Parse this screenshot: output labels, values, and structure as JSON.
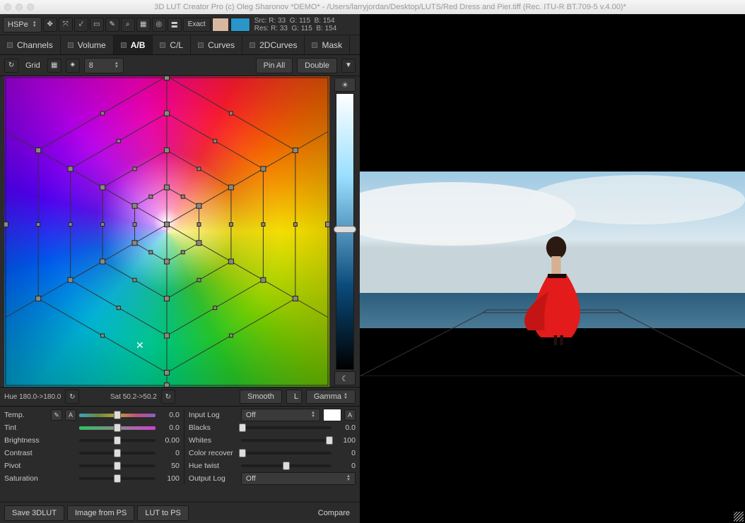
{
  "window": {
    "title": "3D LUT Creator Pro (c) Oleg Sharonov *DEMO* - /Users/larryjordan/Desktop/LUTS/Red Dress and Pier.tiff (Rec. ITU-R BT.709-5 v.4.00)*"
  },
  "toolbar": {
    "mode": "HSPe",
    "exact": "Exact",
    "src_label": "Src:",
    "res_label": "Res:",
    "readout": {
      "src": {
        "r": "R:  33",
        "g": "G: 115",
        "b": "B: 154"
      },
      "res": {
        "r": "R:  33",
        "g": "G: 115",
        "b": "B: 154"
      }
    }
  },
  "tabs": {
    "channels": "Channels",
    "volume": "Volume",
    "ab": "A/B",
    "cl": "C/L",
    "curves": "Curves",
    "curves2d": "2DCurves",
    "mask": "Mask"
  },
  "gridrow": {
    "reset_tip": "↻",
    "grid_label": "Grid",
    "grid_value": "8",
    "pin_all": "Pin All",
    "double": "Double"
  },
  "hs": {
    "hue": "Hue 180.0->180.0",
    "sat": "Sat 50.2->50.2",
    "smooth": "Smooth",
    "L": "L",
    "gamma": "Gamma"
  },
  "slidersA": {
    "temp": {
      "label": "Temp.",
      "value": "0.0",
      "a": "A"
    },
    "tint": {
      "label": "Tint",
      "value": "0.0"
    },
    "brightness": {
      "label": "Brightness",
      "value": "0.00"
    },
    "contrast": {
      "label": "Contrast",
      "value": "0"
    },
    "pivot": {
      "label": "Pivot",
      "value": "50"
    },
    "saturation": {
      "label": "Saturation",
      "value": "100"
    }
  },
  "slidersB": {
    "input_log": {
      "label": "Input Log",
      "value": "Off",
      "a": "A"
    },
    "blacks": {
      "label": "Blacks",
      "value": "0.0"
    },
    "whites": {
      "label": "Whites",
      "value": "100"
    },
    "color_recover": {
      "label": "Color recover",
      "value": "0"
    },
    "hue_twist": {
      "label": "Hue twist",
      "value": "0"
    },
    "output_log": {
      "label": "Output Log",
      "value": "Off"
    }
  },
  "bottom": {
    "save": "Save 3DLUT",
    "from_ps": "Image from PS",
    "to_ps": "LUT to PS",
    "compare": "Compare"
  }
}
